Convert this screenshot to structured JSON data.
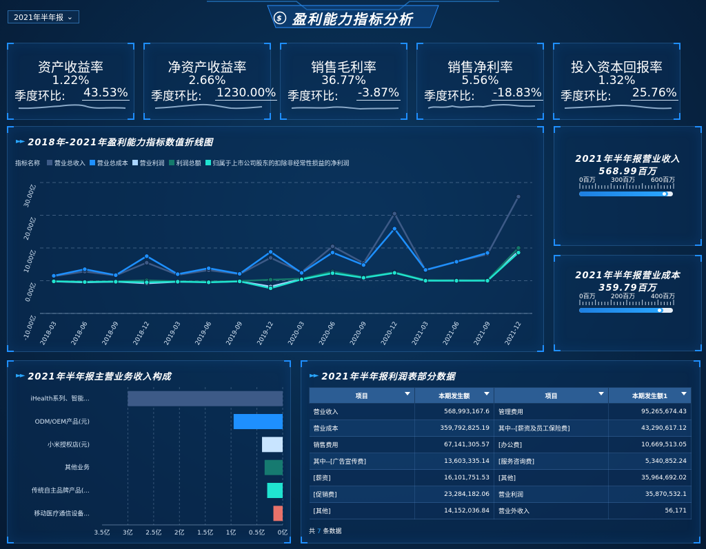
{
  "header": {
    "title": "盈利能力指标分析",
    "period_select": "2021年半年报"
  },
  "kpis": [
    {
      "name": "资产收益率",
      "value": "1.22%",
      "qoq_label": "季度环比:",
      "qoq_value": "43.53%"
    },
    {
      "name": "净资产收益率",
      "value": "2.66%",
      "qoq_label": "季度环比:",
      "qoq_value": "1230.00%"
    },
    {
      "name": "销售毛利率",
      "value": "36.77%",
      "qoq_label": "季度环比:",
      "qoq_value": "-3.87%"
    },
    {
      "name": "销售净利率",
      "value": "5.56%",
      "qoq_label": "季度环比:",
      "qoq_value": "-18.83%"
    },
    {
      "name": "投入资本回报率",
      "value": "1.32%",
      "qoq_label": "季度环比:",
      "qoq_value": "25.76%"
    }
  ],
  "line_panel": {
    "title": "2018年-2021年盈利能力指标数值折线图",
    "legend_label": "指标名称"
  },
  "revenue_panel": {
    "title": "2021年半年报营业收入",
    "value": "568.99百万",
    "ticks": [
      "0百万",
      "300百万",
      "600百万"
    ],
    "progress_fraction": 0.95
  },
  "cost_panel": {
    "title": "2021年半年报营业成本",
    "value": "359.79百万",
    "ticks": [
      "0百万",
      "200百万",
      "400百万"
    ],
    "progress_fraction": 0.9
  },
  "bar_panel": {
    "title": "2021年半年报主营业务收入构成"
  },
  "table_panel": {
    "title": "2021年半年报利润表部分数据",
    "headers": [
      "项目",
      "本期发生额",
      "项目",
      "本期发生额1"
    ],
    "rows": [
      [
        "营业收入",
        "568,993,167.6",
        "管理费用",
        "95,265,674.43"
      ],
      [
        "营业成本",
        "359,792,825.19",
        "其中--[薪资及员工保险费]",
        "43,290,617.12"
      ],
      [
        "销售费用",
        "67,141,305.57",
        "[办公费]",
        "10,669,513.05"
      ],
      [
        "其中--[广告宣传费]",
        "13,603,335.14",
        "[服务咨询费]",
        "5,340,852.24"
      ],
      [
        "[薪资]",
        "16,101,751.53",
        "[其他]",
        "35,964,692.02"
      ],
      [
        "[促销费]",
        "23,284,182.06",
        "营业利润",
        "35,870,532.1"
      ],
      [
        "[其他]",
        "14,152,036.84",
        "营业外收入",
        "56,171"
      ]
    ],
    "footer_prefix": "共",
    "footer_count": "7",
    "footer_suffix": "条数据"
  },
  "chart_data": [
    {
      "type": "line",
      "x": [
        "2018-03",
        "2018-06",
        "2018-09",
        "2018-12",
        "2019-03",
        "2019-06",
        "2019-09",
        "2019-12",
        "2020-03",
        "2020-06",
        "2020-09",
        "2020-12",
        "2021-03",
        "2021-06",
        "2021-09",
        "2021-12"
      ],
      "ylim": [
        -10,
        30
      ],
      "yticks": [
        "-10.00亿",
        "0.00亿",
        "10.00亿",
        "20.00亿",
        "30.00亿"
      ],
      "grid": true,
      "legend_position": "top-left",
      "series": [
        {
          "name": "营业总收入",
          "color": "#3d5a87",
          "values": [
            1.4,
            2.8,
            1.6,
            5.5,
            1.8,
            3.2,
            2.0,
            7.0,
            2.6,
            10.5,
            5.4,
            20.5,
            3.2,
            5.8,
            8.1,
            25.7
          ]
        },
        {
          "name": "营业总成本",
          "color": "#1e90ff",
          "values": [
            1.5,
            3.5,
            1.7,
            7.5,
            2.0,
            3.8,
            2.1,
            8.8,
            2.4,
            8.6,
            4.8,
            15.9,
            3.3,
            5.8,
            8.5,
            null
          ]
        },
        {
          "name": "营业利润",
          "color": "#a9d4ff",
          "values": [
            -0.2,
            -0.5,
            -0.3,
            -0.8,
            -0.3,
            -0.4,
            -0.2,
            -1.8,
            0.5,
            2.5,
            1.0,
            2.5,
            0.1,
            0.1,
            0.1,
            9.0
          ]
        },
        {
          "name": "利润总额",
          "color": "#14796b",
          "values": [
            -0.1,
            -0.3,
            -0.2,
            0.1,
            -0.2,
            -0.3,
            -0.1,
            0.3,
            0.6,
            2.8,
            1.1,
            2.6,
            0.2,
            0.1,
            0.2,
            10.0
          ]
        },
        {
          "name": "归属于上市公司股东的扣除非经常性损益的净利润",
          "color": "#20e3d0",
          "values": [
            -0.2,
            -0.4,
            -0.3,
            -0.5,
            -0.3,
            -0.5,
            -0.2,
            -2.3,
            0.4,
            2.3,
            0.9,
            2.4,
            0.0,
            0.0,
            0.0,
            8.6
          ]
        }
      ]
    },
    {
      "type": "bar",
      "orientation": "horizontal",
      "categories": [
        "iHealth系列、智能...",
        "ODM/OEM产品(元)",
        "小米授权店(元)",
        "其他业务",
        "传统自主品牌产品(...",
        "移动医疗通信设备..."
      ],
      "values": [
        3.0,
        0.95,
        0.4,
        0.35,
        0.3,
        0.18
      ],
      "colors": [
        "#3d5a87",
        "#1e90ff",
        "#c8e4ff",
        "#167a70",
        "#20e3d0",
        "#e8726a"
      ],
      "xlim": [
        0,
        3.5
      ],
      "xticks": [
        "3.5亿",
        "3亿",
        "2.5亿",
        "2亿",
        "1.5亿",
        "1亿",
        "0.5亿",
        "0亿"
      ],
      "reversed_x": true
    }
  ]
}
